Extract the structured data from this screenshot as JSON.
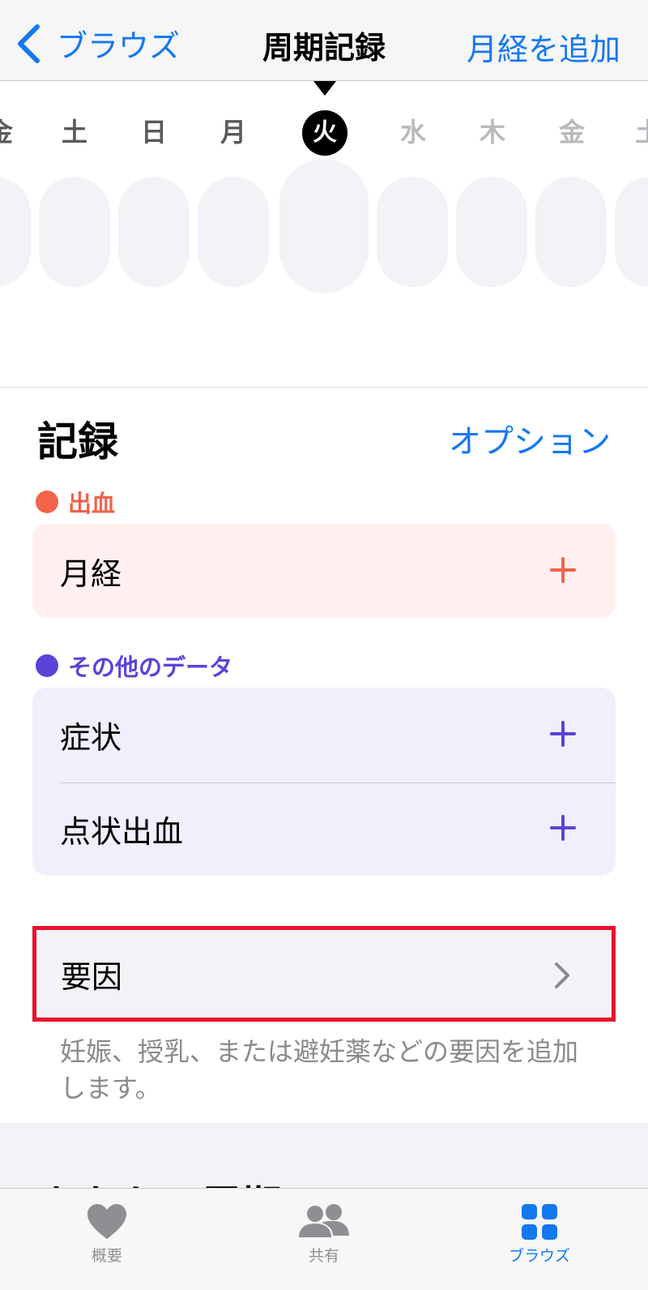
{
  "nav": {
    "back_label": "ブラウズ",
    "title": "周期記録",
    "action_label": "月経を追加"
  },
  "week": {
    "days": [
      {
        "label": "金",
        "state": "past"
      },
      {
        "label": "土",
        "state": "past"
      },
      {
        "label": "日",
        "state": "past"
      },
      {
        "label": "月",
        "state": "past"
      },
      {
        "label": "火",
        "state": "today"
      },
      {
        "label": "水",
        "state": "future"
      },
      {
        "label": "木",
        "state": "future"
      },
      {
        "label": "金",
        "state": "future"
      },
      {
        "label": "土",
        "state": "future"
      }
    ]
  },
  "records": {
    "title": "記録",
    "options_label": "オプション",
    "bleeding": {
      "label": "出血",
      "color": "#f2634a",
      "card_bg": "#fff0ef",
      "items": [
        {
          "label": "月経"
        }
      ]
    },
    "other": {
      "label": "その他のデータ",
      "color": "#5b43d9",
      "card_bg": "#f0effb",
      "items": [
        {
          "label": "症状"
        },
        {
          "label": "点状出血"
        }
      ]
    },
    "factors": {
      "label": "要因",
      "hint": "妊娠、授乳、または避妊薬などの要因を追加します。"
    }
  },
  "cycle": {
    "title": "あなたの周期"
  },
  "tabbar": {
    "tabs": [
      {
        "label": "概要",
        "icon": "heart-icon",
        "active": false
      },
      {
        "label": "共有",
        "icon": "people-icon",
        "active": false
      },
      {
        "label": "ブラウズ",
        "icon": "grid-icon",
        "active": true
      }
    ]
  },
  "colors": {
    "accent": "#1478f0",
    "highlight_border": "#e8102c"
  }
}
